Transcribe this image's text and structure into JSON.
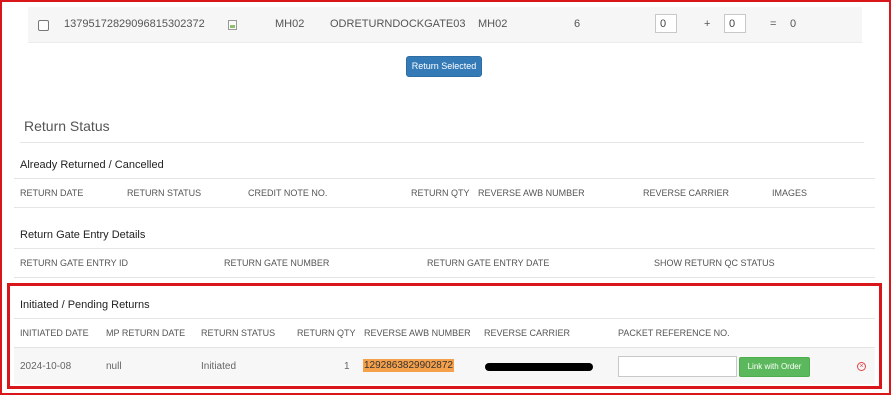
{
  "item_row": {
    "order_id": "13795172829096815302372",
    "warehouse": "MH02",
    "gate": "ODRETURNDOCKGATE03",
    "warehouse2": "MH02",
    "quantity": "6",
    "input_a": "0",
    "plus": "+",
    "input_b": "0",
    "equals": "=",
    "total": "0"
  },
  "return_selected_label": "Return Selected",
  "return_status_title": "Return Status",
  "already_returned": {
    "title": "Already Returned / Cancelled",
    "headers": [
      "RETURN DATE",
      "RETURN STATUS",
      "CREDIT NOTE NO.",
      "RETURN QTY",
      "REVERSE AWB NUMBER",
      "REVERSE CARRIER",
      "IMAGES"
    ]
  },
  "gate_entry": {
    "title": "Return Gate Entry Details",
    "headers": [
      "RETURN GATE ENTRY ID",
      "RETURN GATE NUMBER",
      "RETURN GATE ENTRY DATE",
      "SHOW RETURN QC STATUS"
    ]
  },
  "pending": {
    "title": "Initiated / Pending Returns",
    "headers": [
      "INITIATED DATE",
      "MP RETURN DATE",
      "RETURN STATUS",
      "RETURN QTY",
      "REVERSE AWB NUMBER",
      "REVERSE CARRIER",
      "PACKET REFERENCE NO."
    ],
    "row": {
      "initiated_date": "2024-10-08",
      "mp_return_date": "null",
      "status": "Initiated",
      "qty": "1",
      "awb": "1292863829902872",
      "packet_ref": ""
    },
    "link_label": "Link with Order"
  },
  "colors": {
    "accent_blue": "#337ab7",
    "green": "#5cb85c",
    "highlight_red": "#d9171b",
    "awb_orange": "#f5a04b"
  }
}
